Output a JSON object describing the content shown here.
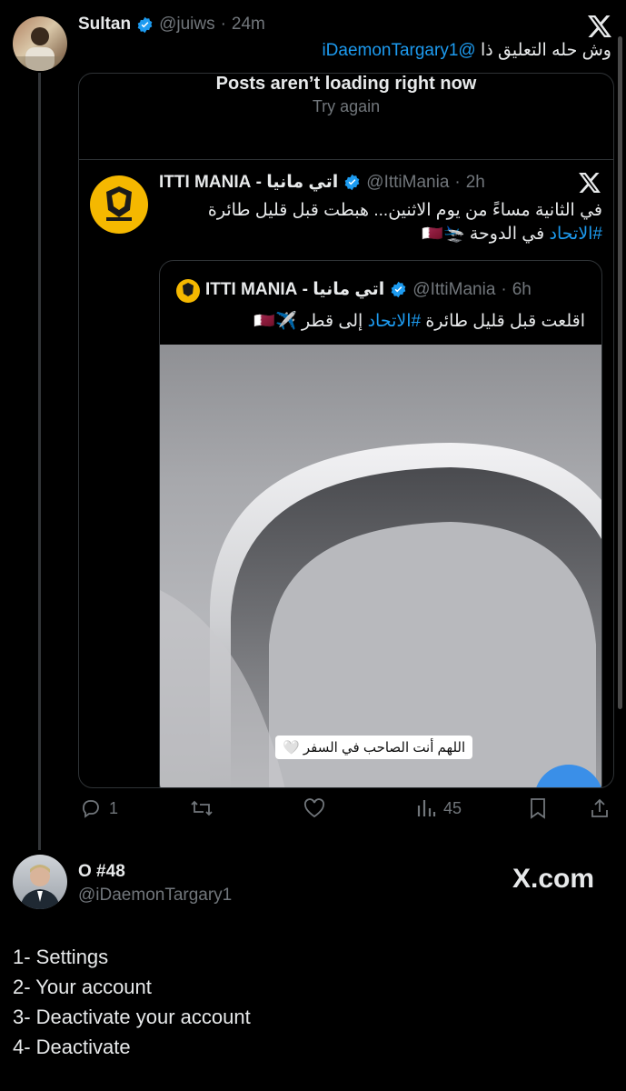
{
  "reply_post": {
    "author_name": "Sultan",
    "author_handle": "@juiws",
    "separator": "·",
    "time": "24m",
    "text_prefix": "وش حله التعليق ذا",
    "mention": "@iDaemonTargary1"
  },
  "error_card": {
    "title": "Posts aren’t loading right now",
    "retry": "Try again"
  },
  "quoted_post": {
    "author_name": "اتي مانيا - ITTI MANIA",
    "author_handle": "@IttiMania",
    "separator": "·",
    "time": "2h",
    "line1": "في الثانية مساءً من يوم الاثنين... هبطت قبل قليل طائرة",
    "hashtag": "#الاتحاد",
    "line2_rest": "في الدوحة 🛬🇶🇦"
  },
  "nested_post": {
    "author_name": "اتي مانيا - ITTI MANIA",
    "author_handle": "@IttiMania",
    "separator": "·",
    "time": "6h",
    "text_prefix": "اقلعت قبل قليل طائرة",
    "hashtag": "#الاتحاد",
    "text_suffix": "إلى قطر ✈️🇶🇦",
    "image_caption": "اللهم أنت الصاحب في السفر 🤍"
  },
  "actions": {
    "replies": "1",
    "retweets": "",
    "likes": "",
    "views": "45"
  },
  "profile": {
    "name": "O #48",
    "handle": "@iDaemonTargary1",
    "watermark": "X.com"
  },
  "steps": [
    "1- Settings",
    "2- Your account",
    "3- Deactivate your account",
    "4- Deactivate"
  ],
  "colors": {
    "accent": "#1d9bf0",
    "secondary_text": "#71767b",
    "border": "#2f3336",
    "itti_yellow": "#f5b800"
  }
}
